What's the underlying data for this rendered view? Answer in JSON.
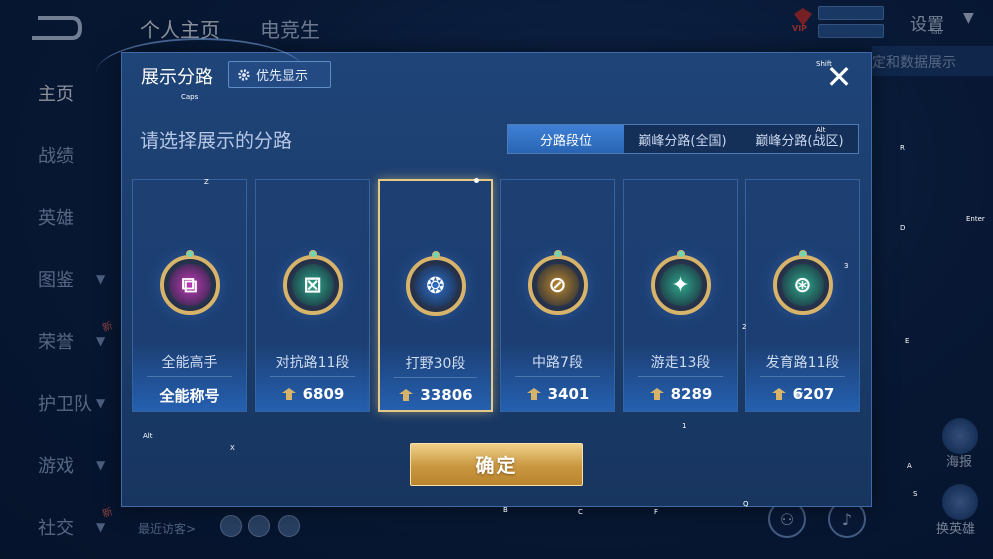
{
  "top_tabs": [
    "个人主页",
    "电竞生"
  ],
  "sidebar": [
    {
      "label": "主页",
      "active": true,
      "chev": false,
      "new": false
    },
    {
      "label": "战绩",
      "active": false,
      "chev": false,
      "new": false
    },
    {
      "label": "英雄",
      "active": false,
      "chev": false,
      "new": false
    },
    {
      "label": "图鉴",
      "active": false,
      "chev": true,
      "new": false
    },
    {
      "label": "荣誉",
      "active": false,
      "chev": true,
      "new": true
    },
    {
      "label": "护卫队",
      "active": false,
      "chev": true,
      "new": false
    },
    {
      "label": "游戏",
      "active": false,
      "chev": true,
      "new": false
    },
    {
      "label": "社交",
      "active": false,
      "chev": true,
      "new": true
    }
  ],
  "header": {
    "vip": "VIP",
    "settings": "设置",
    "settings_key": "Tab",
    "right_strip": "定和数据展示"
  },
  "new_badge": "新",
  "right_buttons": {
    "report": "海报",
    "switch_hero": "换英雄"
  },
  "bottom": {
    "recent_visitors": "最近访客>"
  },
  "key_hints": [
    "Caps",
    "Z",
    "X",
    "R",
    "D",
    "Enter",
    "E",
    "3",
    "2",
    "1",
    "A",
    "S",
    "B",
    "C",
    "F",
    "Q",
    "Alt",
    "Shift",
    "Alt",
    "W"
  ],
  "dialog": {
    "title": "展示分路",
    "priority_label": "优先显示",
    "close": "✕",
    "subtitle": "请选择展示的分路",
    "segments": [
      "分路段位",
      "巅峰分路(全国)",
      "巅峰分路(战区)"
    ],
    "active_segment": 0,
    "confirm": "确定",
    "cards": [
      {
        "name": "全能高手",
        "value": "全能称号",
        "show_power": false,
        "glyph": "⧉",
        "core_color": "#c03ab8",
        "selected": false
      },
      {
        "name": "对抗路11段",
        "value": "6809",
        "show_power": true,
        "glyph": "⊠",
        "core_color": "#2fa68a",
        "selected": false
      },
      {
        "name": "打野30段",
        "value": "33806",
        "show_power": true,
        "glyph": "❂",
        "core_color": "#2e6fc8",
        "selected": true
      },
      {
        "name": "中路7段",
        "value": "3401",
        "show_power": true,
        "glyph": "⊘",
        "core_color": "#b8862f",
        "selected": false
      },
      {
        "name": "游走13段",
        "value": "8289",
        "show_power": true,
        "glyph": "✦",
        "core_color": "#2fa68a",
        "selected": false
      },
      {
        "name": "发育路11段",
        "value": "6207",
        "show_power": true,
        "glyph": "⊛",
        "core_color": "#2fa68a",
        "selected": false
      }
    ]
  },
  "colors": {
    "accent_gold": "#e7c986",
    "active_tab": "#3f80d6"
  }
}
